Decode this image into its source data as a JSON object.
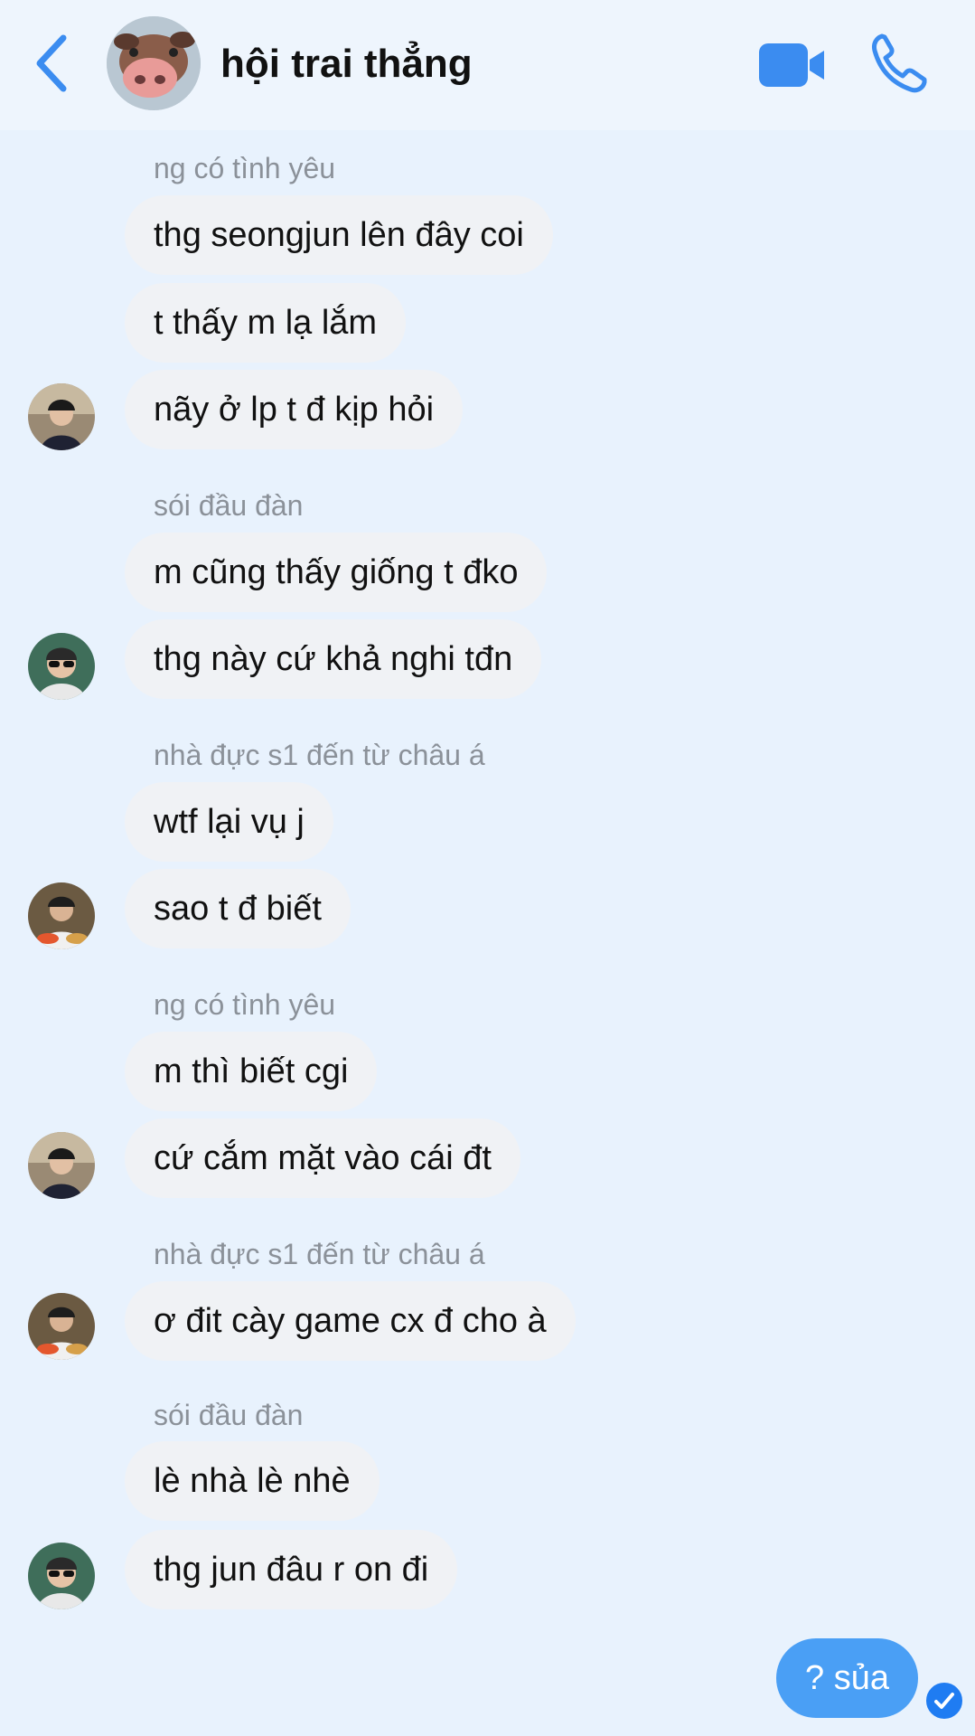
{
  "header": {
    "title": "hội trai thẳng",
    "accent_color": "#3b8cf0",
    "icons": [
      "back-chevron-icon",
      "video-call-icon",
      "phone-icon"
    ]
  },
  "messages": [
    {
      "sender": "ng có tình yêu",
      "avatar": "avatar-cap-boy",
      "bubbles": [
        "thg seongjun lên đây coi",
        "t thấy m lạ lắm",
        "nãy ở lp t đ kịp hỏi"
      ]
    },
    {
      "sender": "sói đầu đàn",
      "avatar": "avatar-sunglasses",
      "bubbles": [
        "m cũng thấy giống t đko",
        "thg này cứ khả nghi tđn"
      ]
    },
    {
      "sender": "nhà đực s1 đến từ châu á",
      "avatar": "avatar-food",
      "bubbles": [
        "wtf lại vụ j",
        "sao t đ biết"
      ]
    },
    {
      "sender": "ng có tình yêu",
      "avatar": "avatar-cap-boy",
      "bubbles": [
        "m thì biết cgi",
        "cứ cắm mặt vào cái đt"
      ]
    },
    {
      "sender": "nhà đực s1 đến từ châu á",
      "avatar": "avatar-food",
      "bubbles": [
        "ơ đit cày game cx đ cho à"
      ]
    },
    {
      "sender": "sói đầu đàn",
      "avatar": "avatar-sunglasses",
      "bubbles": [
        "lè nhà lè nhè",
        "thg jun đâu r on đi"
      ]
    }
  ],
  "my_message": {
    "text": "? sủa",
    "status_icon": "seen-check-icon"
  }
}
